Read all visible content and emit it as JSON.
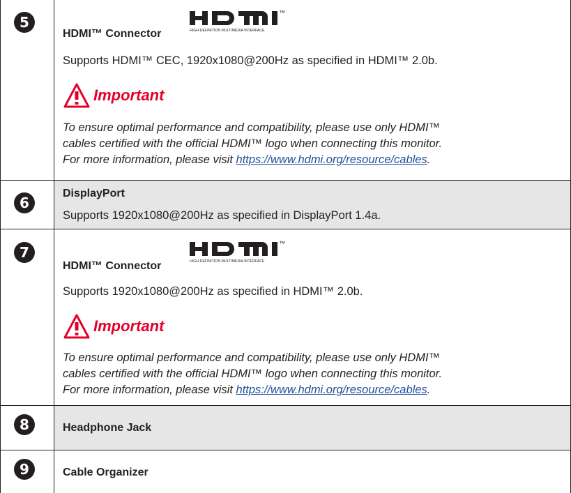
{
  "rows": [
    {
      "number": "5",
      "title": "HDMI™ Connector",
      "logo_text": "HDMI",
      "logo_tm": "™",
      "logo_sub": "HIGH-DEFINITION MULTIMEDIA INTERFACE",
      "description": "Supports HDMI™ CEC, 1920x1080@200Hz as specified in HDMI™ 2.0b.",
      "important_label": "Important",
      "note_line1": "To ensure optimal performance and compatibility, please use only HDMI™",
      "note_line2": "cables certified with the official HDMI™ logo when connecting this monitor.",
      "note_line3_prefix": "For more information, please visit ",
      "note_link": "https://www.hdmi.org/resource/cables",
      "note_line3_suffix": "."
    },
    {
      "number": "6",
      "title": "DisplayPort",
      "description": "Supports 1920x1080@200Hz as specified in DisplayPort 1.4a."
    },
    {
      "number": "7",
      "title": "HDMI™ Connector",
      "logo_text": "HDMI",
      "logo_tm": "™",
      "logo_sub": "HIGH-DEFINITION MULTIMEDIA INTERFACE",
      "description": "Supports 1920x1080@200Hz as specified in HDMI™ 2.0b.",
      "important_label": "Important",
      "note_line1": "To ensure optimal performance and compatibility, please use only HDMI™",
      "note_line2": "cables certified with the official HDMI™ logo when connecting this monitor.",
      "note_line3_prefix": "For more information, please visit ",
      "note_link": "https://www.hdmi.org/resource/cables",
      "note_line3_suffix": "."
    },
    {
      "number": "8",
      "title": "Headphone Jack"
    },
    {
      "number": "9",
      "title": "Cable Organizer"
    }
  ],
  "colors": {
    "important": "#e4002b",
    "link": "#1f4e9c",
    "shade": "#e6e6e6",
    "line": "#231f20"
  }
}
